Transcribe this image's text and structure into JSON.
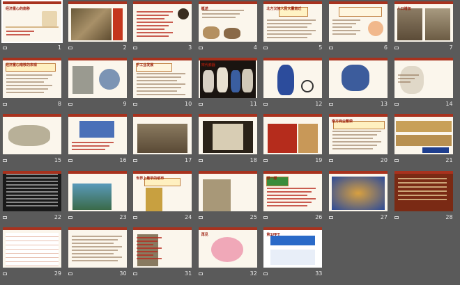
{
  "slides": [
    {
      "n": "1",
      "title": "经济重心的南移"
    },
    {
      "n": "2",
      "title": ""
    },
    {
      "n": "3",
      "title": ""
    },
    {
      "n": "4",
      "title": "概述"
    },
    {
      "n": "5",
      "title": "北方汉族人民大量南迁"
    },
    {
      "n": "6",
      "title": ""
    },
    {
      "n": "7",
      "title": "人口增加"
    },
    {
      "n": "8",
      "title": "经济重心南移的表现"
    },
    {
      "n": "9",
      "title": ""
    },
    {
      "n": "10",
      "title": "手工业发展"
    },
    {
      "n": "11",
      "title": "宋代瓷器"
    },
    {
      "n": "12",
      "title": ""
    },
    {
      "n": "13",
      "title": ""
    },
    {
      "n": "14",
      "title": ""
    },
    {
      "n": "15",
      "title": ""
    },
    {
      "n": "16",
      "title": ""
    },
    {
      "n": "17",
      "title": ""
    },
    {
      "n": "18",
      "title": ""
    },
    {
      "n": "19",
      "title": ""
    },
    {
      "n": "20",
      "title": "南方商业繁荣"
    },
    {
      "n": "21",
      "title": ""
    },
    {
      "n": "22",
      "title": ""
    },
    {
      "n": "23",
      "title": ""
    },
    {
      "n": "24",
      "title": "世界上最早的纸币"
    },
    {
      "n": "25",
      "title": ""
    },
    {
      "n": "26",
      "title": "想一想"
    },
    {
      "n": "27",
      "title": ""
    },
    {
      "n": "28",
      "title": ""
    },
    {
      "n": "29",
      "title": ""
    },
    {
      "n": "30",
      "title": ""
    },
    {
      "n": "31",
      "title": ""
    },
    {
      "n": "32",
      "title": "再见"
    },
    {
      "n": "33",
      "title": "第1PPT"
    }
  ],
  "slide1_subtitle": "第4课",
  "slide26_header": "想一想",
  "slide32_text": "再见",
  "slide33_brand": "第1PPT"
}
